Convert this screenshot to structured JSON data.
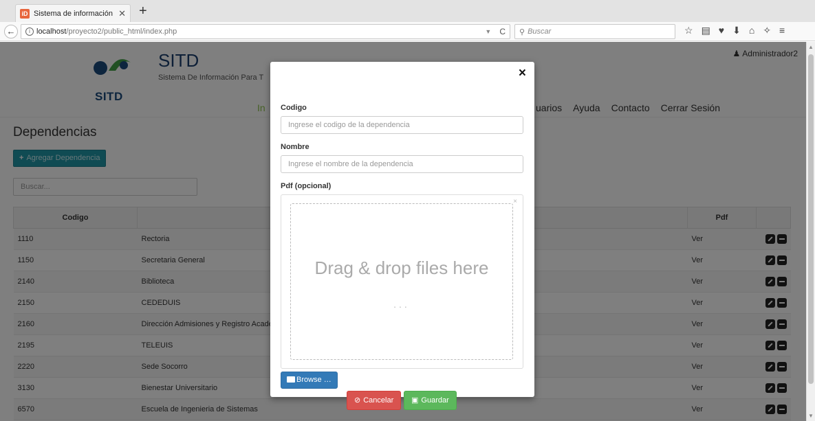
{
  "browser": {
    "tab_title": "Sistema de información par",
    "tab_favicon": "iD",
    "url_host": "localhost",
    "url_path": "/proyecto2/public_html/index.php",
    "search_placeholder": "Buscar"
  },
  "header": {
    "logo_text": "SITD",
    "title": "SITD",
    "subtitle": "Sistema De Información Para T",
    "user": "Administrador2",
    "menu_left": "In",
    "menu_right": [
      "uarios",
      "Ayuda",
      "Contacto",
      "Cerrar Sesión"
    ]
  },
  "main": {
    "page_title": "Dependencias",
    "add_button": "Agregar Dependencia",
    "search_placeholder": "Buscar...",
    "table": {
      "columns": [
        "Codigo",
        "",
        "Pdf",
        ""
      ],
      "rows": [
        {
          "codigo": "1110",
          "nombre": "Rectoria",
          "pdf": "Ver"
        },
        {
          "codigo": "1150",
          "nombre": "Secretaria General",
          "pdf": "Ver"
        },
        {
          "codigo": "2140",
          "nombre": "Biblioteca",
          "pdf": "Ver"
        },
        {
          "codigo": "2150",
          "nombre": "CEDEDUIS",
          "pdf": "Ver"
        },
        {
          "codigo": "2160",
          "nombre": "Dirección Admisiones y Registro Acadé",
          "pdf": "Ver"
        },
        {
          "codigo": "2195",
          "nombre": "TELEUIS",
          "pdf": "Ver"
        },
        {
          "codigo": "2220",
          "nombre": "Sede Socorro",
          "pdf": "Ver"
        },
        {
          "codigo": "3130",
          "nombre": "Bienestar Universitario",
          "pdf": "Ver"
        },
        {
          "codigo": "6570",
          "nombre": "Escuela de Ingenieria de Sistemas",
          "pdf": "Ver"
        }
      ]
    }
  },
  "modal": {
    "close": "×",
    "codigo_label": "Codigo",
    "codigo_placeholder": "Ingrese el codigo de la dependencia",
    "nombre_label": "Nombre",
    "nombre_placeholder": "Ingrese el nombre de la dependencia",
    "pdf_label": "Pdf (opcional)",
    "drop_text": "Drag & drop files here",
    "drop_dots": "...",
    "drop_close": "×",
    "browse": "Browse …",
    "cancel": "Cancelar",
    "save": "Guardar"
  },
  "colors": {
    "accent_teal": "#2196a7",
    "link_green": "#a4cf5d",
    "cancel_red": "#d9534f",
    "save_green": "#5cb85c",
    "browse_blue": "#337ab7"
  }
}
